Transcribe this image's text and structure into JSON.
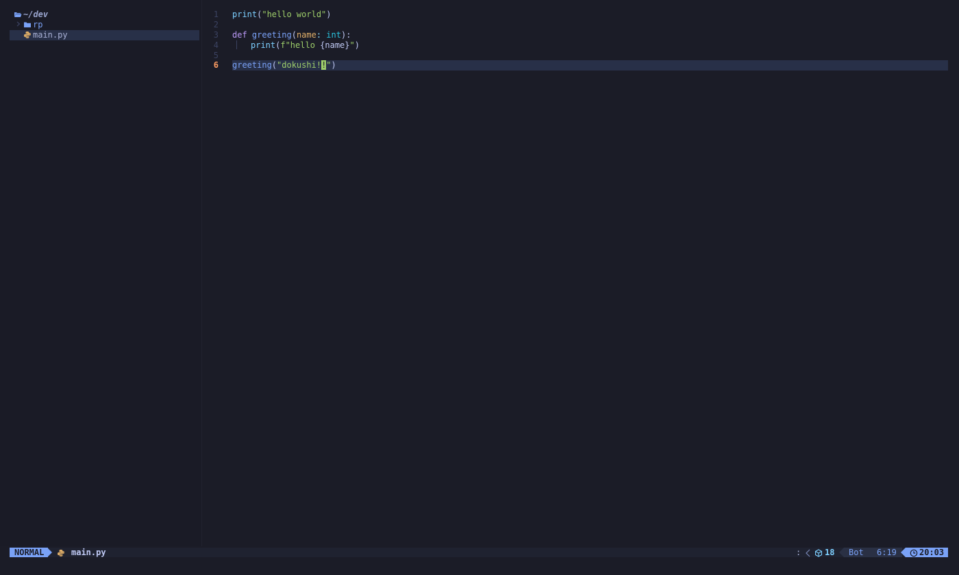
{
  "sidebar": {
    "root": {
      "label": "~/dev",
      "icon": "folder-open-icon"
    },
    "items": [
      {
        "label": "rp",
        "icon": "folder-icon",
        "type": "folder",
        "expanded": false
      },
      {
        "label": "main.py",
        "icon": "python-icon",
        "type": "file",
        "selected": true
      }
    ]
  },
  "editor": {
    "current_line": 6,
    "lines": [
      {
        "num": "1",
        "segments": [
          [
            "t-fn",
            "print"
          ],
          [
            "t-fg",
            "("
          ],
          [
            "t-str",
            "\"hello world\""
          ],
          [
            "t-fg",
            ")"
          ]
        ]
      },
      {
        "num": "2",
        "segments": []
      },
      {
        "num": "3",
        "segments": [
          [
            "t-kw",
            "def "
          ],
          [
            "t-fn2",
            "greeting"
          ],
          [
            "t-fg",
            "("
          ],
          [
            "t-par",
            "name"
          ],
          [
            "t-pun",
            ": "
          ],
          [
            "t-type",
            "int"
          ],
          [
            "t-fg",
            "):"
          ]
        ]
      },
      {
        "num": "4",
        "indent_guide": true,
        "segments": [
          [
            "t-fn",
            "print"
          ],
          [
            "t-fg",
            "("
          ],
          [
            "t-str",
            "f\"hello "
          ],
          [
            "t-fg",
            "{name}"
          ],
          [
            "t-str",
            "\""
          ],
          [
            "t-fg",
            ")"
          ]
        ]
      },
      {
        "num": "5",
        "segments": []
      },
      {
        "num": "6",
        "segments": [
          [
            "t-fn2",
            "greeting"
          ],
          [
            "t-fg",
            "("
          ],
          [
            "t-str",
            "\"dokushi!"
          ],
          [
            "cursor",
            "!"
          ],
          [
            "t-str",
            "\""
          ],
          [
            "t-fg",
            ")"
          ]
        ]
      }
    ]
  },
  "statusline": {
    "mode": "NORMAL",
    "file_icon": "python-icon",
    "file_name": "main.py",
    "separator": ":",
    "lsp_icon": "package-icon",
    "lsp_count": "18",
    "scroll": "Bot",
    "position": "6:19",
    "clock_icon": "clock-icon",
    "time": "20:03"
  },
  "colors": {
    "background": "#1b1c27",
    "accent": "#7aa2f7",
    "cursor": "#9ece6a",
    "current_line_number": "#ff9e64"
  }
}
